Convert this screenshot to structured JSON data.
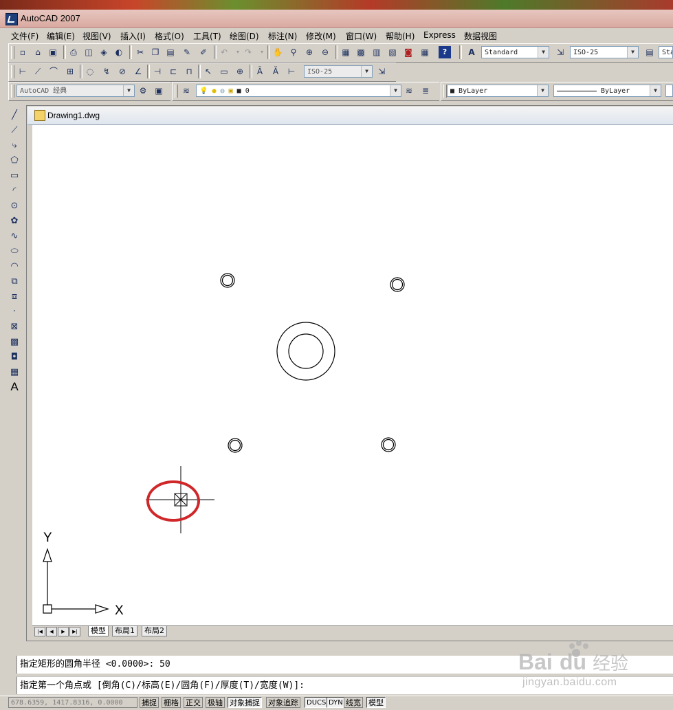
{
  "app": {
    "title": "AutoCAD 2007"
  },
  "menu": [
    "文件(F)",
    "编辑(E)",
    "视图(V)",
    "插入(I)",
    "格式(O)",
    "工具(T)",
    "绘图(D)",
    "标注(N)",
    "修改(M)",
    "窗口(W)",
    "帮助(H)",
    "Express",
    "数据视图"
  ],
  "toolbar": {
    "text_style": "Standard",
    "dim_style": "ISO-25",
    "dim_style_clipped": "Sta",
    "dim_style_2": "ISO-25",
    "workspace": "AutoCAD 经典",
    "layer": "0",
    "color": "ByLayer",
    "linetype": "ByLayer"
  },
  "icons": {
    "standard": [
      "new-icon",
      "open-icon",
      "save-icon",
      "print-icon",
      "print-preview-icon",
      "publish-icon",
      "3d-dwf-icon",
      "cut-icon",
      "copy-icon",
      "paste-icon",
      "match-properties-icon",
      "block-editor-icon",
      "undo-icon",
      "redo-icon",
      "pan-icon",
      "zoom-realtime-icon",
      "zoom-window-icon",
      "zoom-previous-icon",
      "properties-icon",
      "design-center-icon",
      "tool-palettes-icon",
      "sheet-set-icon",
      "markup-icon",
      "quickcalc-icon",
      "help-icon"
    ],
    "dimension": [
      "linear-dim-icon",
      "aligned-dim-icon",
      "arc-length-icon",
      "ordinate-dim-icon",
      "radius-dim-icon",
      "jogged-dim-icon",
      "diameter-dim-icon",
      "angular-dim-icon",
      "quick-dim-icon",
      "baseline-dim-icon",
      "continue-dim-icon",
      "quick-leader-icon",
      "tolerance-icon",
      "center-mark-icon",
      "dim-edit-icon",
      "dim-text-edit-icon",
      "dim-update-icon",
      "dim-style-icon"
    ],
    "draw": [
      "line-icon",
      "construction-line-icon",
      "polyline-icon",
      "polygon-icon",
      "rectangle-icon",
      "arc-icon",
      "circle-icon",
      "revision-cloud-icon",
      "spline-icon",
      "ellipse-icon",
      "ellipse-arc-icon",
      "insert-block-icon",
      "make-block-icon",
      "point-icon",
      "hatch-icon",
      "gradient-icon",
      "region-icon",
      "table-icon",
      "multiline-text-icon"
    ]
  },
  "document": {
    "title": "Drawing1.dwg"
  },
  "ucs": {
    "x_label": "X",
    "y_label": "Y"
  },
  "layout_tabs": [
    "模型",
    "布局1",
    "布局2"
  ],
  "command_history": "指定矩形的圆角半径 <0.0000>: 50",
  "command_prompt": "指定第一个角点或 [倒角(C)/标高(E)/圆角(F)/厚度(T)/宽度(W)]:",
  "status": {
    "coordinates": "678.6359, 1417.8316, 0.0000",
    "buttons": [
      "捕捉",
      "栅格",
      "正交",
      "极轴",
      "对象捕捉",
      "对象追踪",
      "DUCS",
      "DYN",
      "线宽",
      "模型"
    ]
  },
  "watermark": {
    "logo": "Baidu经验",
    "url": "jingyan.baidu.com"
  },
  "colors": {
    "title_bar": "#d9a9a0",
    "highlight_circle": "#d0282a",
    "background": "#d4d0c8"
  }
}
